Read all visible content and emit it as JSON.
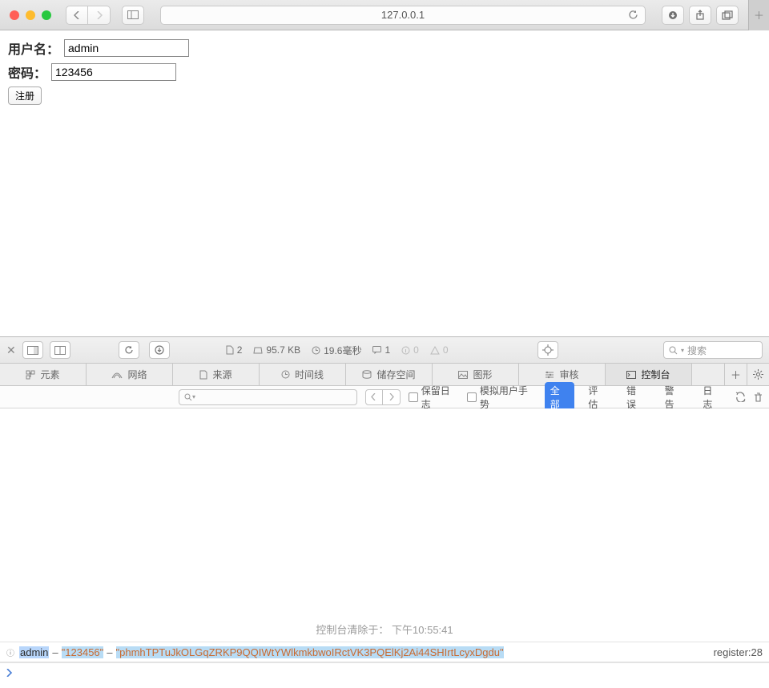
{
  "browser": {
    "url": "127.0.0.1"
  },
  "form": {
    "username_label": "用户名：",
    "username_value": "admin",
    "password_label": "密码：",
    "password_value": "123456",
    "submit_label": "注册"
  },
  "devtools": {
    "stats": {
      "docs": "2",
      "size": "95.7 KB",
      "time": "19.6毫秒",
      "msgs": "1",
      "info": "0",
      "warn": "0"
    },
    "search_placeholder": "搜索",
    "tabs": {
      "elements": "元素",
      "network": "网络",
      "sources": "来源",
      "timeline": "时间线",
      "storage": "储存空间",
      "graphics": "图形",
      "audit": "审核",
      "console": "控制台"
    },
    "filter": {
      "preserve_log": "保留日志",
      "simulate_gesture": "模拟用户手势",
      "all": "全部",
      "eval": "评估",
      "error": "错误",
      "warn": "警告",
      "log": "日志"
    },
    "cleared_at_prefix": "控制台清除于：",
    "cleared_at_time": "下午10:55:41",
    "log": {
      "v1": "admin",
      "v2": "\"123456\"",
      "v3": "\"phmhTPTuJkOLGqZRKP9QQIWtYWlkmkbwoIRctVK3PQElKj2Ai44SHIrtLcyxDgdu\"",
      "source": "register:28"
    }
  }
}
